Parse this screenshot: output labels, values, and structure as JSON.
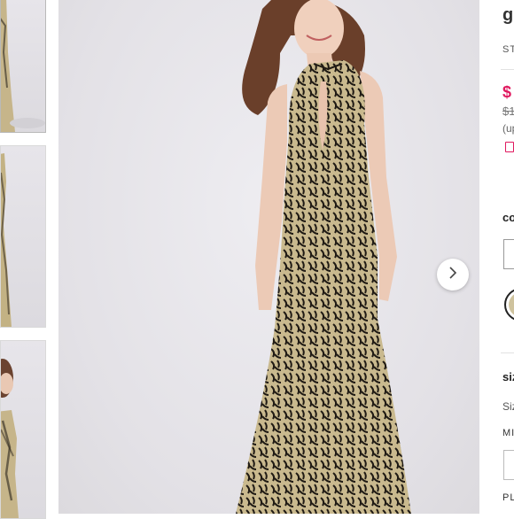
{
  "thumbnails": [
    {
      "label": "Thumbnail 1",
      "active": true
    },
    {
      "label": "Thumbnail 2",
      "active": false
    },
    {
      "label": "Thumbnail 3",
      "active": false
    }
  ],
  "main_image": {
    "icon": "next-arrow-icon"
  },
  "product_panel": {
    "title_partial": "g",
    "style_partial": "ST",
    "sale_price_partial": "$",
    "original_price_partial": "$1",
    "price_note_partial": "(up",
    "color_label_partial": "co",
    "size_label_partial": "siz",
    "size_guide_partial": "Siz",
    "size_option_partial": "MI",
    "bottom_label_partial": "PL"
  },
  "colors": {
    "accent": "#e0195f",
    "swatch_gold": "#cfc39e",
    "background": "#e6e4e9"
  }
}
